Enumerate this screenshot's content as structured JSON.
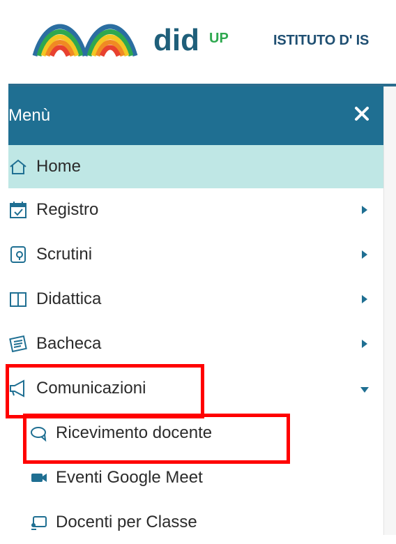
{
  "header": {
    "logo_text": "did",
    "logo_superscript": "UP",
    "school_title": "ISTITUTO D' IS"
  },
  "sidebar": {
    "menu_title": "Menù",
    "items": [
      {
        "label": "Home",
        "icon": "home-icon"
      },
      {
        "label": "Registro",
        "icon": "calendar-check-icon"
      },
      {
        "label": "Scrutini",
        "icon": "document-stamp-icon"
      },
      {
        "label": "Didattica",
        "icon": "book-icon"
      },
      {
        "label": "Bacheca",
        "icon": "board-icon"
      },
      {
        "label": "Comunicazioni",
        "icon": "megaphone-icon"
      }
    ],
    "subitems": [
      {
        "label": "Ricevimento docente",
        "icon": "chat-icon"
      },
      {
        "label": "Eventi Google Meet",
        "icon": "video-camera-icon"
      },
      {
        "label": "Docenti per Classe",
        "icon": "presentation-icon"
      }
    ]
  },
  "colors": {
    "menu_header_bg": "#1f6f92",
    "home_highlight_bg": "#bfe7e5",
    "annotation_red": "#ff0000",
    "icon_blue": "#1f6f92"
  }
}
